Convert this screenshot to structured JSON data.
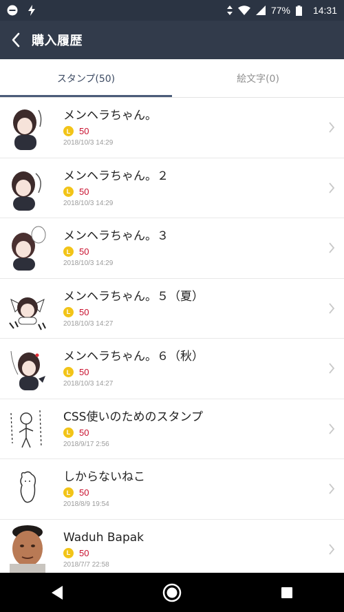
{
  "status_bar": {
    "battery": "77%",
    "time": "14:31",
    "icons": [
      "do-not-disturb-icon",
      "flash-icon",
      "data-arrows-icon",
      "wifi-icon",
      "cell-signal-icon",
      "battery-icon"
    ]
  },
  "header": {
    "title": "購入履歴",
    "back_icon": "back-arrow-icon"
  },
  "tabs": [
    {
      "label": "スタンプ(50)",
      "active": true
    },
    {
      "label": "絵文字(0)",
      "active": false
    }
  ],
  "purchases": [
    {
      "title": "メンヘラちゃん。",
      "price": "50",
      "date": "2018/10/3 14:29"
    },
    {
      "title": "メンヘラちゃん。２",
      "price": "50",
      "date": "2018/10/3 14:29"
    },
    {
      "title": "メンヘラちゃん。３",
      "price": "50",
      "date": "2018/10/3 14:29"
    },
    {
      "title": "メンヘラちゃん。５（夏）",
      "price": "50",
      "date": "2018/10/3 14:27"
    },
    {
      "title": "メンヘラちゃん。６（秋）",
      "price": "50",
      "date": "2018/10/3 14:27"
    },
    {
      "title": "CSS使いのためのスタンプ",
      "price": "50",
      "date": "2018/9/17 2:56"
    },
    {
      "title": "しからないねこ",
      "price": "50",
      "date": "2018/8/9 19:54"
    },
    {
      "title": "Waduh Bapak",
      "price": "50",
      "date": "2018/7/7 22:58"
    }
  ],
  "coin_symbol": "L",
  "colors": {
    "header_bg": "#323b4b",
    "status_bg": "#2b3443",
    "price": "#c8102e",
    "coin": "#f2c418",
    "active_tab": "#4a5b78"
  }
}
